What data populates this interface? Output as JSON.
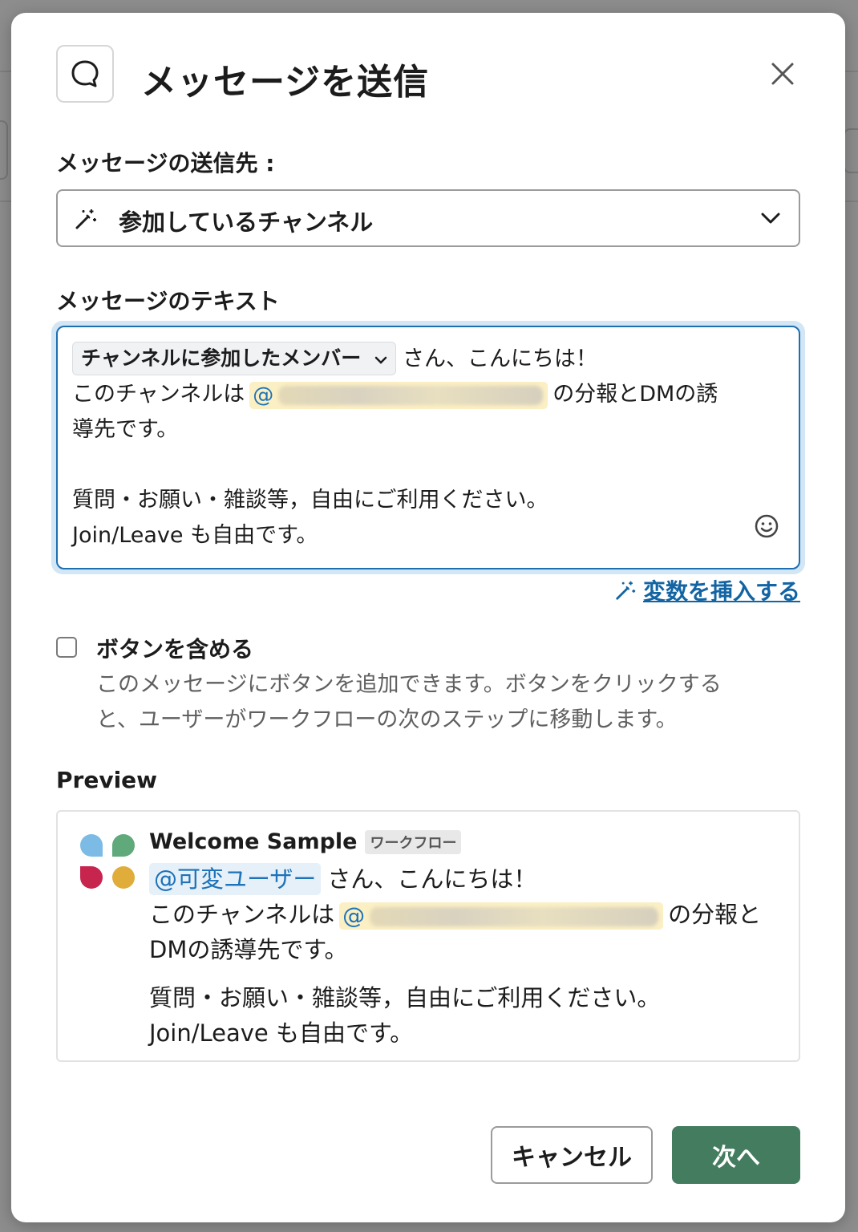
{
  "dialog": {
    "title": "メッセージを送信",
    "close_icon": "close-icon"
  },
  "recipient": {
    "label": "メッセージの送信先 :",
    "value": "参加しているチャンネル"
  },
  "message": {
    "label": "メッセージのテキスト",
    "variable_chip": "チャンネルに参加したメンバー",
    "line1_after_chip": "さん、こんにちは！",
    "line2_before_mention": "このチャンネルは",
    "mention_prefix": "@",
    "line2_after_mention": "の分報とDMの誘",
    "line3": "導先です。",
    "line4": "質問・お願い・雑談等，自由にご利用ください。",
    "line5": "Join/Leave も自由です。"
  },
  "insert_variable": {
    "label": "変数を挿入する"
  },
  "include_button": {
    "label": "ボタンを含める",
    "description_line1": "このメッセージにボタンを追加できます。ボタンをクリックする",
    "description_line2": "と、ユーザーがワークフローの次のステップに移動します。",
    "checked": false
  },
  "preview": {
    "label": "Preview",
    "sender_name": "Welcome Sample",
    "badge": "ワークフロー",
    "mention": "@可変ユーザー",
    "line1_after_mention": "さん、こんにちは！",
    "line2_before_mention": "このチャンネルは",
    "mention_prefix": "@",
    "line2_after_mention": "の分報と",
    "line3": "DMの誘導先です。",
    "line4": "質問・お願い・雑談等，自由にご利用ください。",
    "line5": "Join/Leave も自由です。"
  },
  "footer": {
    "cancel_label": "キャンセル",
    "next_label": "次へ"
  },
  "colors": {
    "primary_button": "#447c5f",
    "link": "#1264a3",
    "focus_ring": "#1d6fb1"
  }
}
